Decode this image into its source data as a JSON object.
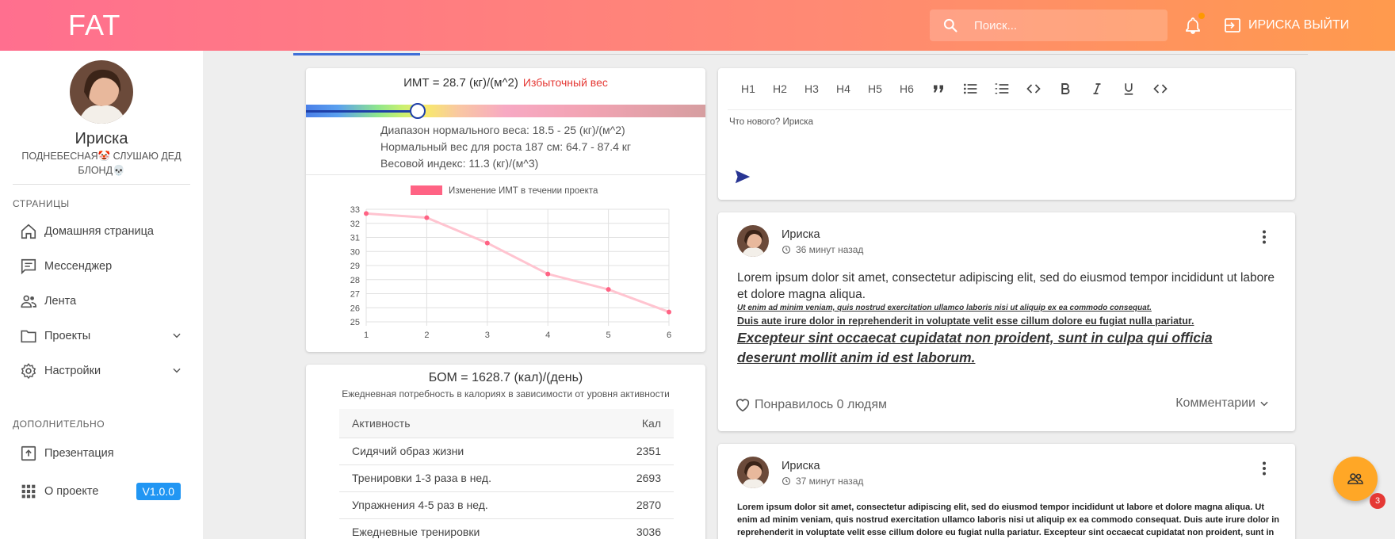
{
  "app": {
    "brand": "FAT"
  },
  "header": {
    "search_placeholder": "Поиск...",
    "logout_label": "ИРИСКА ВЫЙТИ",
    "icons": [
      "search-icon",
      "bell-icon",
      "logout-icon"
    ]
  },
  "profile": {
    "name": "Ириска",
    "status": "ПОДНЕБЕСНАЯ🤡 СЛУШАЮ ДЕД БЛОНД💀"
  },
  "sidebar": {
    "section_pages": "СТРАНИЦЫ",
    "section_extra": "ДОПОЛНИТЕЛЬНО",
    "items": [
      {
        "label": "Домашняя страница",
        "icon": "home-icon"
      },
      {
        "label": "Мессенджер",
        "icon": "message-icon"
      },
      {
        "label": "Лента",
        "icon": "people-icon"
      },
      {
        "label": "Проекты",
        "icon": "folder-icon"
      },
      {
        "label": "Настройки",
        "icon": "gear-icon"
      }
    ],
    "extra_items": [
      {
        "label": "Презентация",
        "icon": "presentation-icon"
      },
      {
        "label": "О проекте",
        "icon": "apps-icon",
        "badge": "V1.0.0"
      }
    ]
  },
  "bmi": {
    "title": "ИМТ = 28.7 (кг)/(м^2)",
    "status": "Избыточный вес",
    "slider_percent": 28,
    "lines": [
      "Диапазон нормального веса: 18.5 - 25 (кг)/(м^2)",
      "Нормальный вес для роста 187 см: 64.7 - 87.4 кг",
      "Весовой индекс: 11.3 (кг)/(м^3)"
    ]
  },
  "chart_data": {
    "type": "line",
    "title": "",
    "legend": [
      "Изменение ИМТ в течении проекта"
    ],
    "legend_position": "top",
    "categories": [
      "1",
      "2",
      "3",
      "4",
      "5",
      "6"
    ],
    "series": [
      {
        "name": "Изменение ИМТ в течении проекта",
        "values": [
          32.7,
          32.4,
          30.6,
          28.4,
          27.3,
          25.7
        ],
        "color": "#ff6384"
      }
    ],
    "xlabel": "",
    "ylabel": "",
    "ylim": [
      25,
      33
    ],
    "yticks": [
      "25",
      "26",
      "27",
      "28",
      "29",
      "30",
      "31",
      "32",
      "33"
    ],
    "grid": true
  },
  "bmr": {
    "title": "БОМ = 1628.7 (кал)/(день)",
    "subtitle": "Ежедневная потребность в калориях в зависимости от уровня активности",
    "columns": [
      "Активность",
      "Кал"
    ],
    "rows": [
      {
        "activity": "Сидячий образ жизни",
        "kcal": "2351"
      },
      {
        "activity": "Тренировки 1-3 раза в нед.",
        "kcal": "2693"
      },
      {
        "activity": "Упражнения 4-5 раз в нед.",
        "kcal": "2870"
      },
      {
        "activity": "Ежедневные тренировки",
        "kcal": "3036"
      }
    ]
  },
  "editor": {
    "tools": [
      "H1",
      "H2",
      "H3",
      "H4",
      "H5",
      "H6"
    ],
    "placeholder": "Что нового? Ириска"
  },
  "posts": [
    {
      "author": "Ириска",
      "time": "36 минут назад",
      "p1": "Lorem ipsum dolor sit amet, consectetur adipiscing elit, sed do eiusmod tempor incididunt ut labore et dolore magna aliqua.",
      "p2": "Ut enim ad minim veniam, quis nostrud exercitation ullamco laboris nisi ut aliquip ex ea commodo consequat.",
      "p3": "Duis aute irure dolor in reprehenderit in voluptate velit esse cillum dolore eu fugiat nulla pariatur.",
      "p4": "Excepteur sint occaecat cupidatat non proident, sunt in culpa qui officia deserunt mollit anim id est laborum.",
      "likes": "Понравилось 0 людям",
      "comments": "Комментарии"
    },
    {
      "author": "Ириска",
      "time": "37 минут назад",
      "text": "Lorem ipsum dolor sit amet, consectetur adipiscing elit, sed do eiusmod tempor incididunt ut labore et dolore magna aliqua. Ut enim ad minim veniam, quis nostrud exercitation ullamco laboris nisi ut aliquip ex ea commodo consequat. Duis aute irure dolor in reprehenderit in voluptate velit esse cillum dolore eu fugiat nulla pariatur. Excepteur sint occaecat cupidatat non proident, sunt in"
    }
  ],
  "fab": {
    "badge": "3"
  }
}
